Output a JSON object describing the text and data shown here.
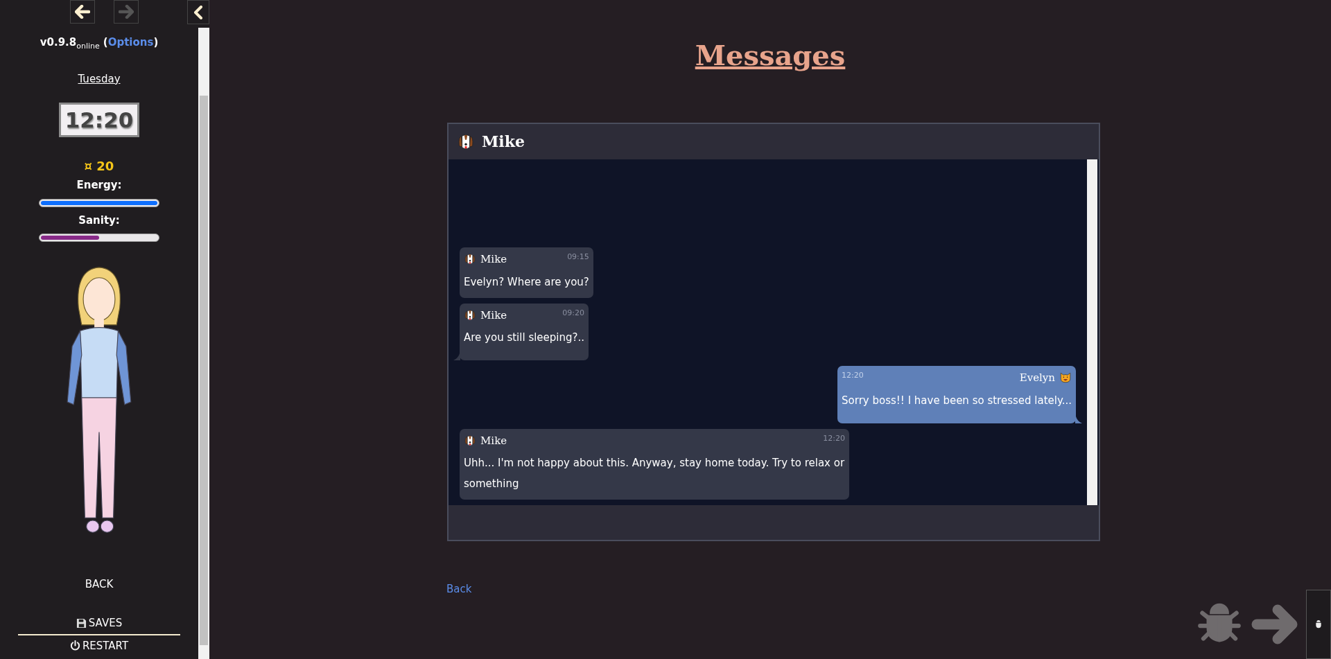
{
  "nav": {
    "back": {
      "disabled": false
    },
    "forward": {
      "disabled": true
    }
  },
  "sidebar": {
    "version": "v0.9.8",
    "version_tag": "online",
    "paren_open": "(",
    "options": "Options",
    "paren_close": ")",
    "day": "Tuesday",
    "clock": "12:20",
    "money": "¤ 20",
    "stats": [
      {
        "label": "Energy:",
        "level": 1.0,
        "color": "#0d6efd"
      },
      {
        "label": "Sanity:",
        "level": 0.5,
        "color": "#882a88"
      }
    ],
    "menu": [
      {
        "label": "BACK",
        "kind": "plain",
        "divider_below": false
      },
      {
        "label": "SAVES",
        "kind": "save",
        "divider_below": true
      },
      {
        "label": "RESTART",
        "kind": "power",
        "divider_below": false
      }
    ]
  },
  "page_title": "Messages",
  "chat": {
    "contact": "Mike",
    "messages": [
      {
        "sender": "Mike",
        "time": "09:15",
        "text": "Evelyn? Where are you?",
        "outgoing": false,
        "tail": false
      },
      {
        "sender": "Mike",
        "time": "09:20",
        "text": "Are you still sleeping?..",
        "outgoing": false,
        "tail": true
      },
      {
        "sender": "Evelyn",
        "time": "12:20",
        "text": "Sorry boss!! I have been so stressed lately...",
        "outgoing": true,
        "tail": true
      },
      {
        "sender": "Mike",
        "time": "12:20",
        "text": "Uhh... I'm not happy about this. Anyway, stay home today. Try to relax or something",
        "outgoing": false,
        "tail": false
      }
    ]
  },
  "back_link": "Back"
}
